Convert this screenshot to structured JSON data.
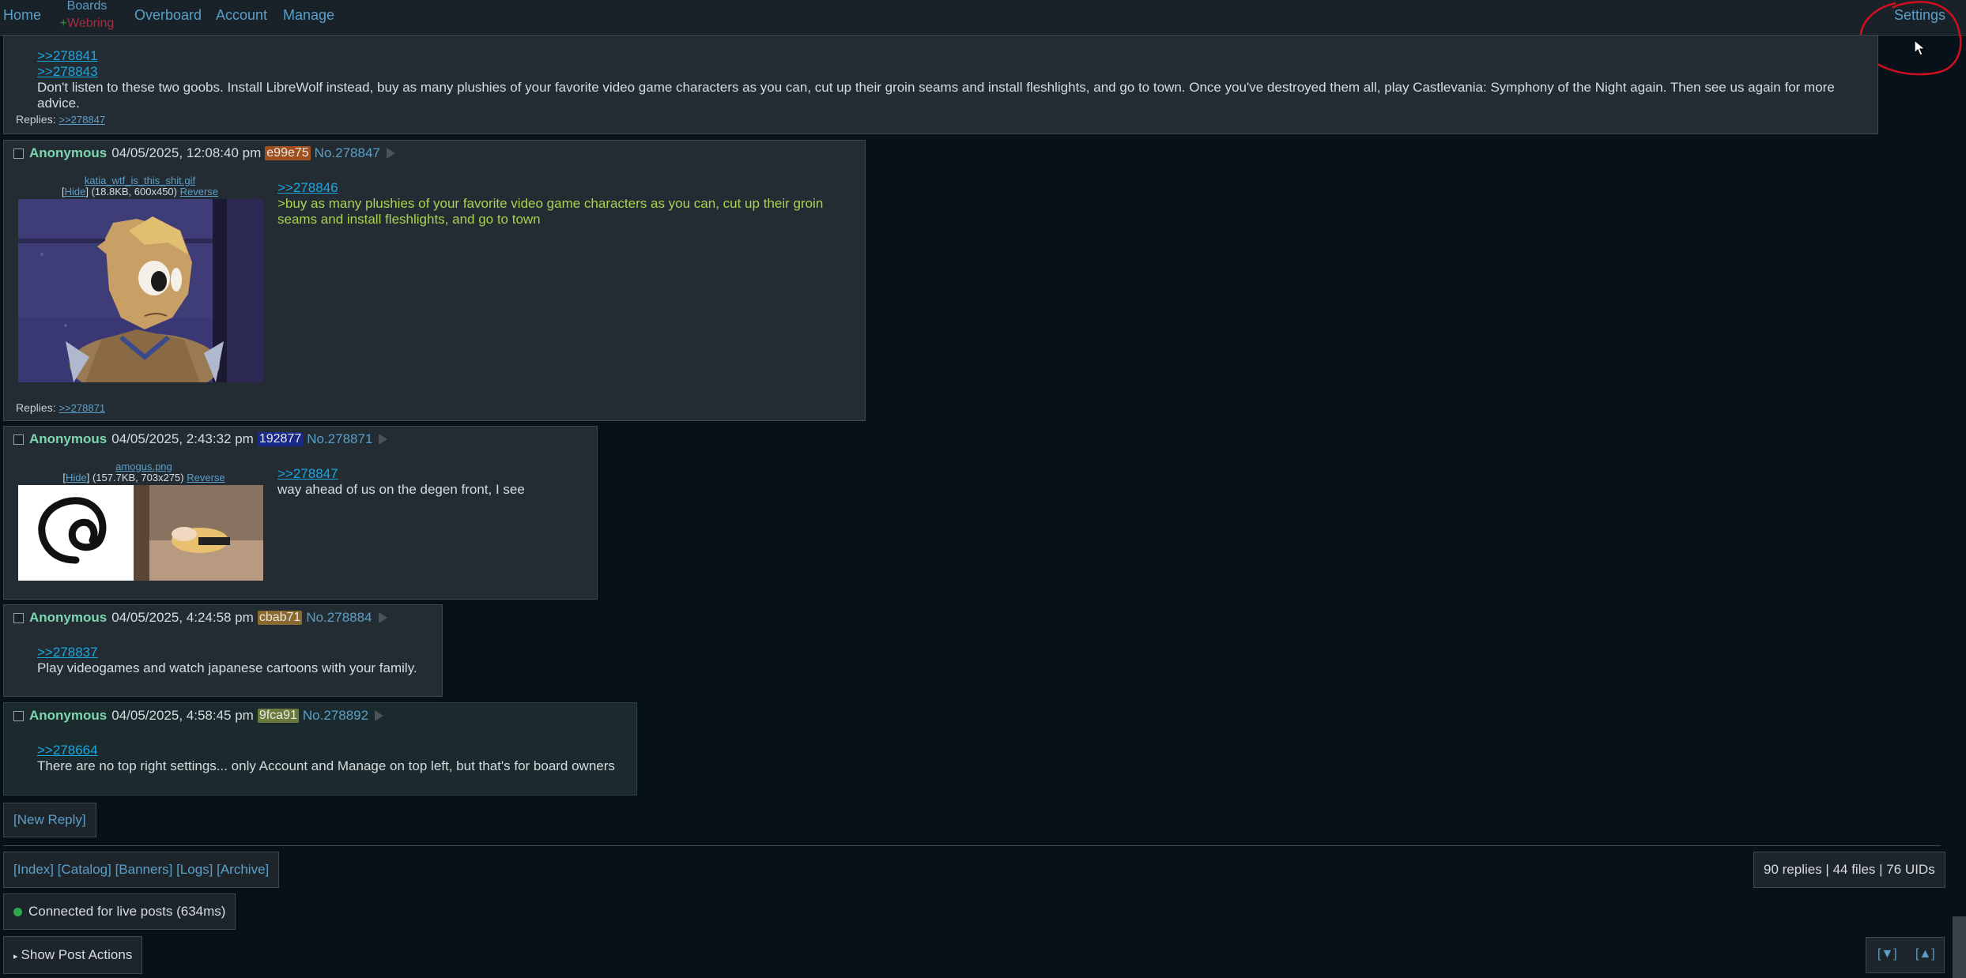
{
  "nav": {
    "home": "Home",
    "boards": "Boards",
    "webring_plus": "+",
    "webring": "Webring",
    "overboard": "Overboard",
    "account": "Account",
    "manage": "Manage",
    "settings": "Settings"
  },
  "op_tail": {
    "quote1": ">>278841",
    "quote2": ">>278843",
    "text": "Don't listen to these two goobs. Install LibreWolf instead, buy as many plushies of your favorite video game characters as you can, cut up their groin seams and install fleshlights, and go to town. Once you've destroyed them all, play Castlevania: Symphony of the Night again. Then see us again for more advice.",
    "replies_label": "Replies:",
    "reply_link": ">>278847"
  },
  "posts": [
    {
      "name": "Anonymous",
      "date": "04/05/2025, 12:08:40 pm",
      "uid": "e99e75",
      "uid_color": "#a0501e",
      "no": "No.278847",
      "file_name": "katia_wtf_is_this_shit.gif",
      "file_hide": "Hide",
      "file_meta": "(18.8KB, 600x450)",
      "file_reverse": "Reverse",
      "quote": ">>278846",
      "greentext": ">buy as many plushies of your favorite video game characters as you can, cut up their groin seams and install fleshlights, and go to town",
      "replies_label": "Replies:",
      "reply_link": ">>278871"
    },
    {
      "name": "Anonymous",
      "date": "04/05/2025, 2:43:32 pm",
      "uid": "192877",
      "uid_color": "#1a2a8a",
      "no": "No.278871",
      "file_name": "amogus.png",
      "file_hide": "Hide",
      "file_meta": "(157.7KB, 703x275)",
      "file_reverse": "Reverse",
      "quote": ">>278847",
      "text": "way ahead of us on the degen front, I see"
    },
    {
      "name": "Anonymous",
      "date": "04/05/2025, 4:24:58 pm",
      "uid": "cbab71",
      "uid_color": "#8a6a2e",
      "no": "No.278884",
      "quote": ">>278837",
      "text": "Play videogames and watch japanese cartoons with your family."
    },
    {
      "name": "Anonymous",
      "date": "04/05/2025, 4:58:45 pm",
      "uid": "9fca91",
      "uid_color": "#6a7a3a",
      "no": "No.278892",
      "quote": ">>278664",
      "text": "There are no top right settings... only Account and Manage on top left, but that's for board owners"
    }
  ],
  "footer": {
    "new_reply": "[New Reply]",
    "links": [
      "[Index]",
      "[Catalog]",
      "[Banners]",
      "[Logs]",
      "[Archive]"
    ],
    "stats": "90 replies | 44 files | 76 UIDs",
    "live": "Connected for live posts (634ms)",
    "show_actions": "Show Post Actions",
    "scroll_down": "[▼]",
    "scroll_up": "[▲]"
  },
  "colors": {
    "background": "#061119",
    "post_bg": "#242c33",
    "link": "#5b9fc8",
    "name": "#7ed6b0",
    "greentext": "#a8d34e",
    "annotation_circle": "#d01020"
  }
}
